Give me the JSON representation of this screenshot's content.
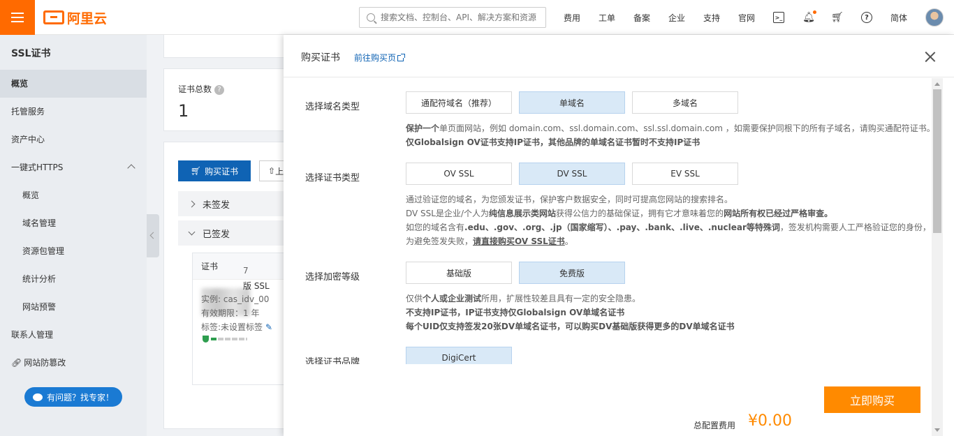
{
  "topbar": {
    "logo_text": "阿里云",
    "search_placeholder": "搜索文档、控制台、API、解决方案和资源",
    "nav": [
      "费用",
      "工单",
      "备案",
      "企业",
      "支持",
      "官网"
    ],
    "icons": [
      "terminal-icon",
      "bell-icon",
      "cart-icon",
      "help-icon"
    ],
    "lang": "简体",
    "accent_color": "#ff6a00"
  },
  "sidebar": {
    "title": "SSL证书",
    "items": [
      {
        "label": "概览",
        "active": true
      },
      {
        "label": "托管服务"
      },
      {
        "label": "资产中心"
      },
      {
        "label": "一键式HTTPS",
        "expanded": true
      },
      {
        "label": "概览",
        "sub": true
      },
      {
        "label": "域名管理",
        "sub": true
      },
      {
        "label": "资源包管理",
        "sub": true
      },
      {
        "label": "统计分析",
        "sub": true
      },
      {
        "label": "网站预警",
        "sub": true
      },
      {
        "label": "联系人管理"
      },
      {
        "label": "网站防篡改"
      }
    ],
    "ask_expert": "有问题？找专家！"
  },
  "main": {
    "cert_total_label": "证书总数",
    "cert_total_value": "1",
    "buy_button": "购买证书",
    "upload_button": "上",
    "unsigned": "未签发",
    "signed": "已签发",
    "cert_col": "证书",
    "cert_name_frag": "7",
    "cert_type_frag": "版 SSL",
    "instance": "实例: cas_idv_00",
    "validity": "有效期限：1 年",
    "tag": "标签:未设置标签"
  },
  "drawer": {
    "title": "购买证书",
    "goto_link": "前往购买页",
    "domain_type": {
      "label": "选择域名类型",
      "options": [
        "通配符域名（推荐）",
        "单域名",
        "多域名"
      ],
      "selected": "单域名",
      "desc1_bold": "保护一个",
      "desc1": "单页面网站，例如 domain.com、ssl.domain.com、ssl.ssl.domain.com ，如需要保护同根下的所有子域名，请购买通配符证书。",
      "desc2": "仅Globalsign OV证书支持IP证书，其他品牌的单域名证书暂时不支持IP证书"
    },
    "cert_type": {
      "label": "选择证书类型",
      "options": [
        "OV SSL",
        "DV SSL",
        "EV SSL"
      ],
      "selected": "DV SSL",
      "desc1": "通过验证您的域名，为您颁发证书，保护客户数据安全，同时可提高您网站的搜索排名。",
      "desc2a": "DV SSL是企业/个人为",
      "desc2b": "纯信息展示类网站",
      "desc2c": "获得公信力的基础保证，拥有它才意味着您的",
      "desc2d": "网站所有权已经过严格审查。",
      "desc3a": "如您的域名含有",
      "desc3b": ".edu、.gov、.org、.jp（国家缩写）、.pay、.bank、.live、.nuclear等特殊词",
      "desc3c": "，签发机构需要人工严格验证您的身份，",
      "desc4a": "为避免签发失败，",
      "desc4b": "请直接购买OV SSL证书",
      "desc4c": "。"
    },
    "encryption": {
      "label": "选择加密等级",
      "options": [
        "基础版",
        "免费版"
      ],
      "selected": "免费版",
      "desc1a": "仅供",
      "desc1b": "个人或企业测试",
      "desc1c": "所用，扩展性较差且具有一定的安全隐患。",
      "desc2": "不支持IP证书，IP证书支持仅Globalsign OV单域名证书",
      "desc3": "每个UID仅支持签发20张DV单域名证书，可以购买DV基础版获得更多的DV单域名证书"
    },
    "brand": {
      "label": "选择证书品牌",
      "options": [
        "DigiCert"
      ],
      "selected": "DigiCert"
    },
    "buy_now": "立即购买",
    "total_label": "总配置费用",
    "total_value": "¥0.00"
  }
}
